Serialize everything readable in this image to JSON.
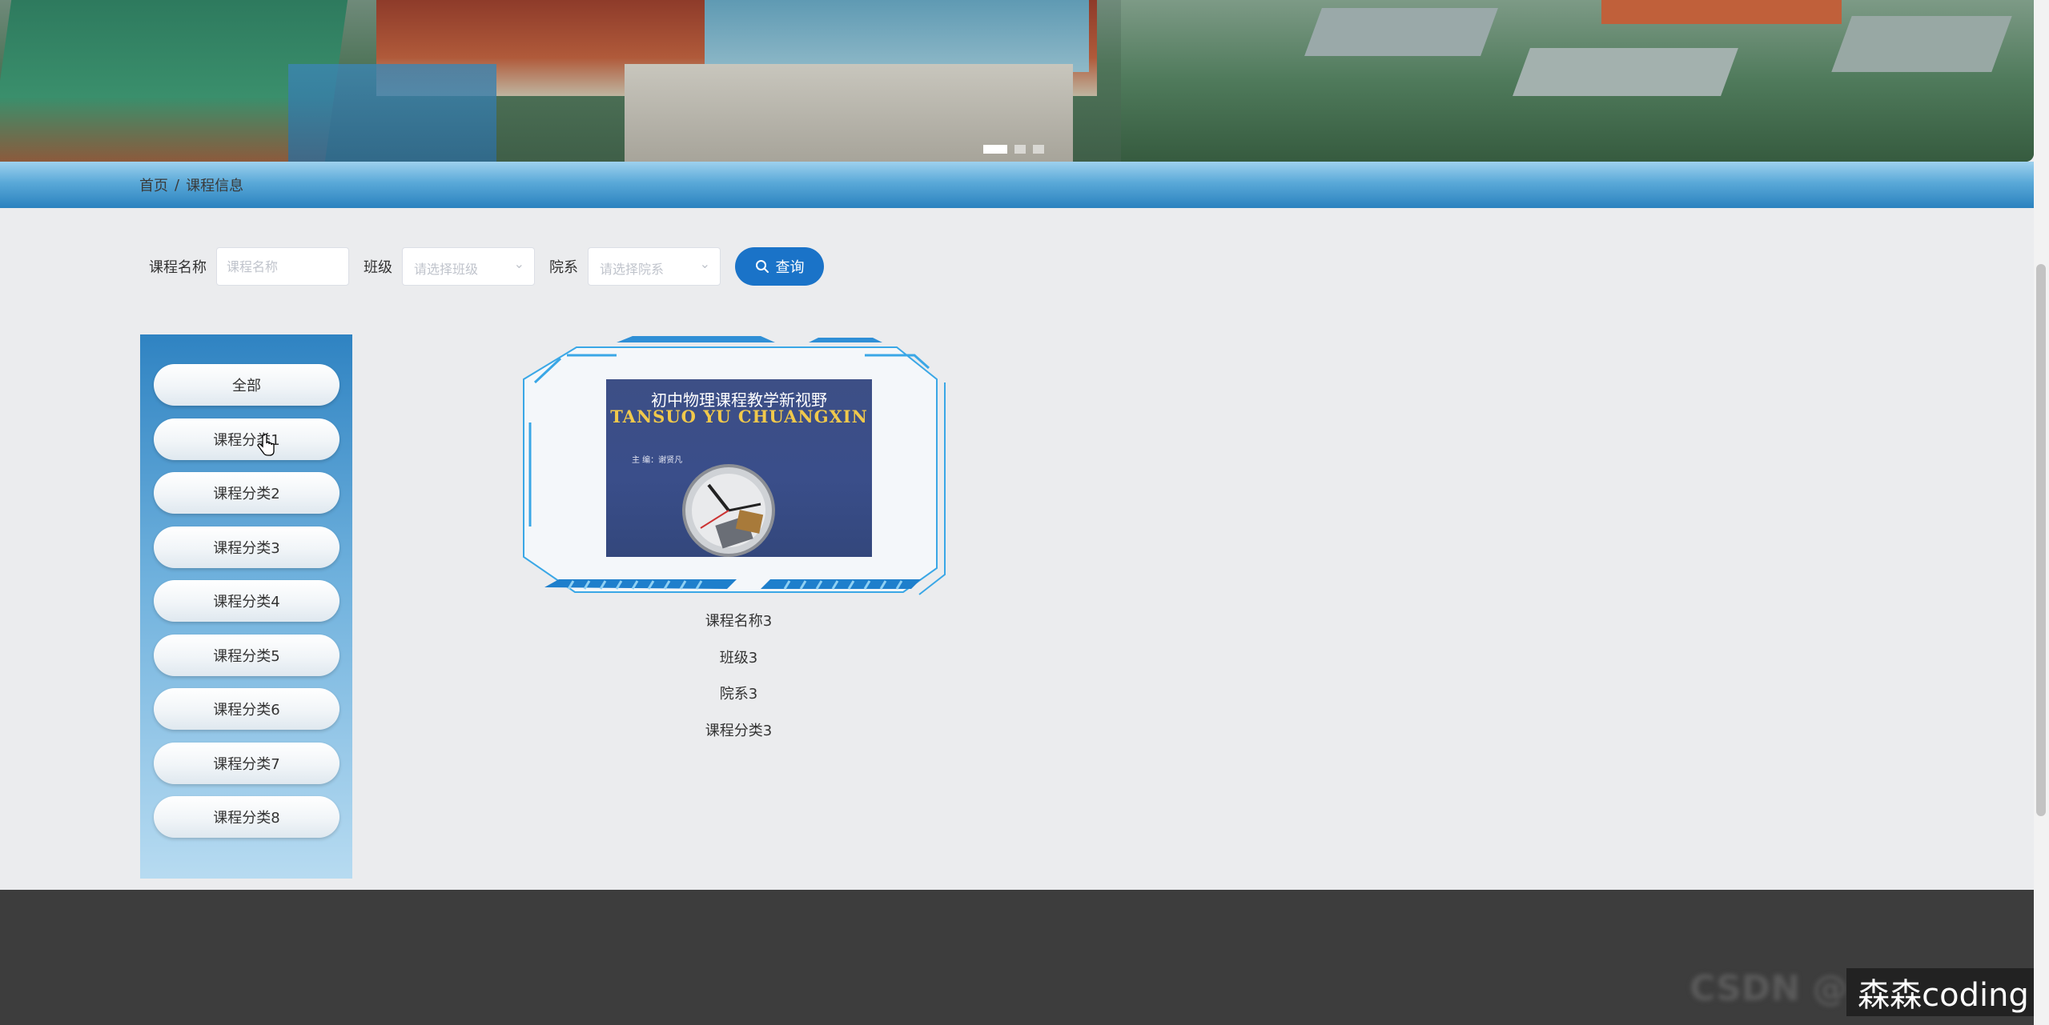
{
  "breadcrumb": {
    "home": "首页",
    "separator": "/",
    "current": "课程信息"
  },
  "banner": {
    "slides": 3,
    "active_slide": 1
  },
  "search": {
    "course_name_label": "课程名称",
    "course_name_placeholder": "课程名称",
    "class_label": "班级",
    "class_placeholder": "请选择班级",
    "department_label": "院系",
    "department_placeholder": "请选择院系",
    "query_label": "查询"
  },
  "categories": [
    "全部",
    "课程分类1",
    "课程分类2",
    "课程分类3",
    "课程分类4",
    "课程分类5",
    "课程分类6",
    "课程分类7",
    "课程分类8"
  ],
  "course": {
    "cover_title_cn": "初中物理课程教学新视野",
    "cover_title_en": "TANSUO YU CHUANGXIN",
    "cover_author": "主 编：谢贤凡",
    "name": "课程名称3",
    "class": "班级3",
    "department": "院系3",
    "category": "课程分类3"
  },
  "footer": {
    "blurred_text": "CSDN @"
  },
  "watermark": "森森coding",
  "colors": {
    "accent": "#1a73c8",
    "sidebar_top": "#2f83c2",
    "footer": "#3d3d3d",
    "page_bg": "#ebecee"
  }
}
